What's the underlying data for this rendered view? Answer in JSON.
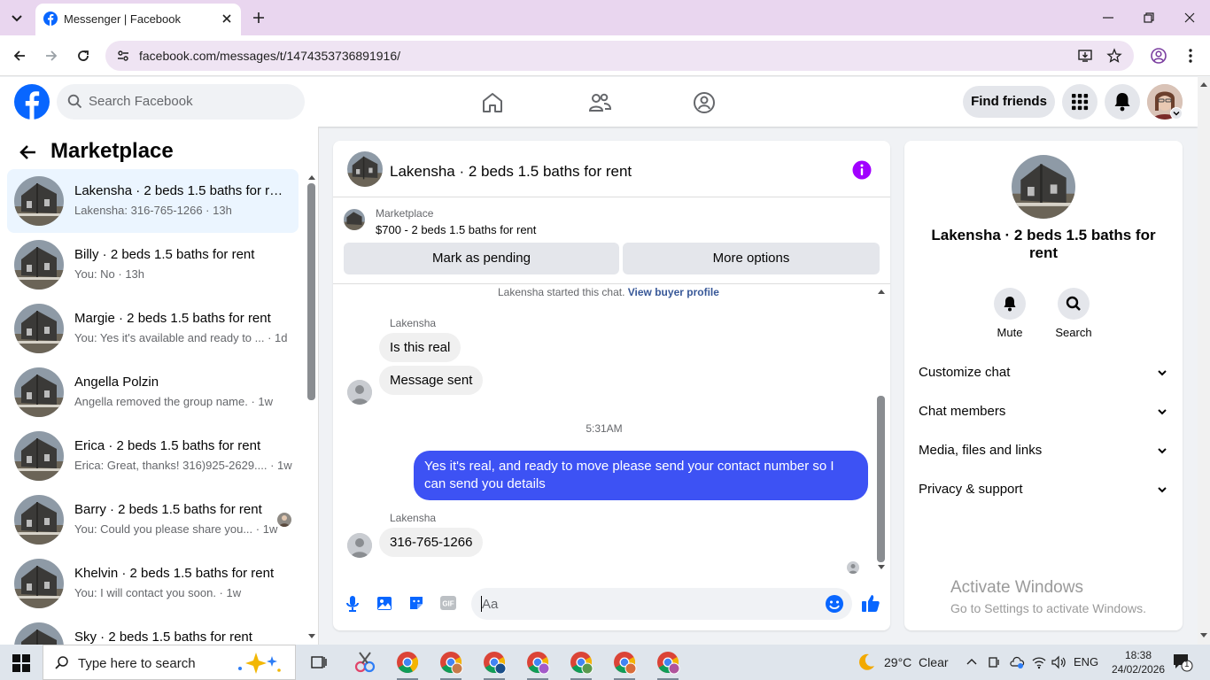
{
  "browser": {
    "tab_title": "Messenger | Facebook",
    "url": "facebook.com/messages/t/1474353736891916/"
  },
  "fb_header": {
    "search_placeholder": "Search Facebook",
    "find_friends": "Find friends"
  },
  "sidebar": {
    "title": "Marketplace",
    "conversations": [
      {
        "name": "Lakensha · 2 beds 1.5 baths for rent",
        "preview": "Lakensha: 316-765-1266 · 13h",
        "active": true
      },
      {
        "name": "Billy · 2 beds 1.5 baths for rent",
        "preview": "You: No · 13h"
      },
      {
        "name": "Margie · 2 beds 1.5 baths for rent",
        "preview": "You: Yes it's available and ready to ... · 1d"
      },
      {
        "name": "Angella Polzin",
        "preview": "Angella removed the group name. · 1w"
      },
      {
        "name": "Erica · 2 beds 1.5 baths for rent",
        "preview": "Erica: Great, thanks! 316)925-2629.... · 1w"
      },
      {
        "name": "Barry · 2 beds 1.5 baths for rent",
        "preview": "You: Could you please share you... · 1w"
      },
      {
        "name": "Khelvin · 2 beds 1.5 baths for rent",
        "preview": "You: I will contact you soon. · 1w"
      },
      {
        "name": "Sky · 2 beds 1.5 baths for rent",
        "preview": ""
      }
    ]
  },
  "chat": {
    "title": "Lakensha · 2 beds 1.5 baths for rent",
    "listing_source": "Marketplace",
    "listing_title": "$700 - 2 beds 1.5 baths for rent",
    "mark_pending": "Mark as pending",
    "more_options": "More options",
    "started_text": "Lakensha started this chat.",
    "view_buyer": "View buyer profile",
    "sender1": "Lakensha",
    "msg1": "Is this real",
    "msg2": "Message sent",
    "timestamp": "5:31AM",
    "msg3": "Yes it's real, and ready to move please send your contact number so I can send you details",
    "sender2": "Lakensha",
    "msg4": "316-765-1266",
    "composer_placeholder": "Aa"
  },
  "info_panel": {
    "name": "Lakensha · 2 beds 1.5 baths for rent",
    "mute": "Mute",
    "search": "Search",
    "items": [
      "Customize chat",
      "Chat members",
      "Media, files and links",
      "Privacy & support"
    ]
  },
  "watermark": {
    "line1": "Activate Windows",
    "line2": "Go to Settings to activate Windows."
  },
  "taskbar": {
    "search_placeholder": "Type here to search",
    "weather": "29°C  Clear",
    "lang": "ENG",
    "time": "18:38",
    "date": "24/02/2026",
    "notifications": "1"
  },
  "colors": {
    "fb_blue": "#0866ff",
    "outgoing_bubble": "#3d52f4",
    "info_icon": "#a100ff"
  }
}
